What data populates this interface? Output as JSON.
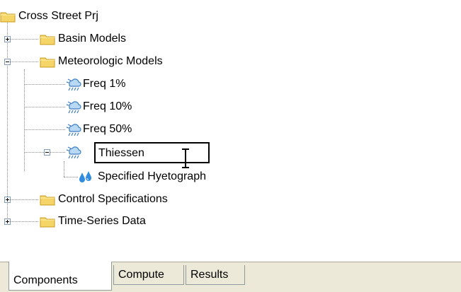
{
  "tree": {
    "root": "Cross Street Prj",
    "basin_models": "Basin Models",
    "meteorologic_models": "Meteorologic Models",
    "met_children": [
      "Freq 1%",
      "Freq 10%",
      "Freq 50%"
    ],
    "thiessen": "Thiessen",
    "specified_hyetograph": "Specified Hyetograph",
    "control_specifications": "Control Specifications",
    "time_series_data": "Time-Series Data"
  },
  "tabs": [
    "Components",
    "Compute",
    "Results"
  ],
  "colors": {
    "folder": "#f5d468",
    "folder_outline": "#c89b1e",
    "cloud": "#3c7fc4",
    "drop": "#2f8ce0",
    "tab_bg": "#ece9d8"
  },
  "icons": {
    "folder": "folder-icon",
    "meteorologic": "rain-cloud-icon",
    "precipitation": "water-drops-icon",
    "cursor": "i-beam-cursor-icon"
  }
}
